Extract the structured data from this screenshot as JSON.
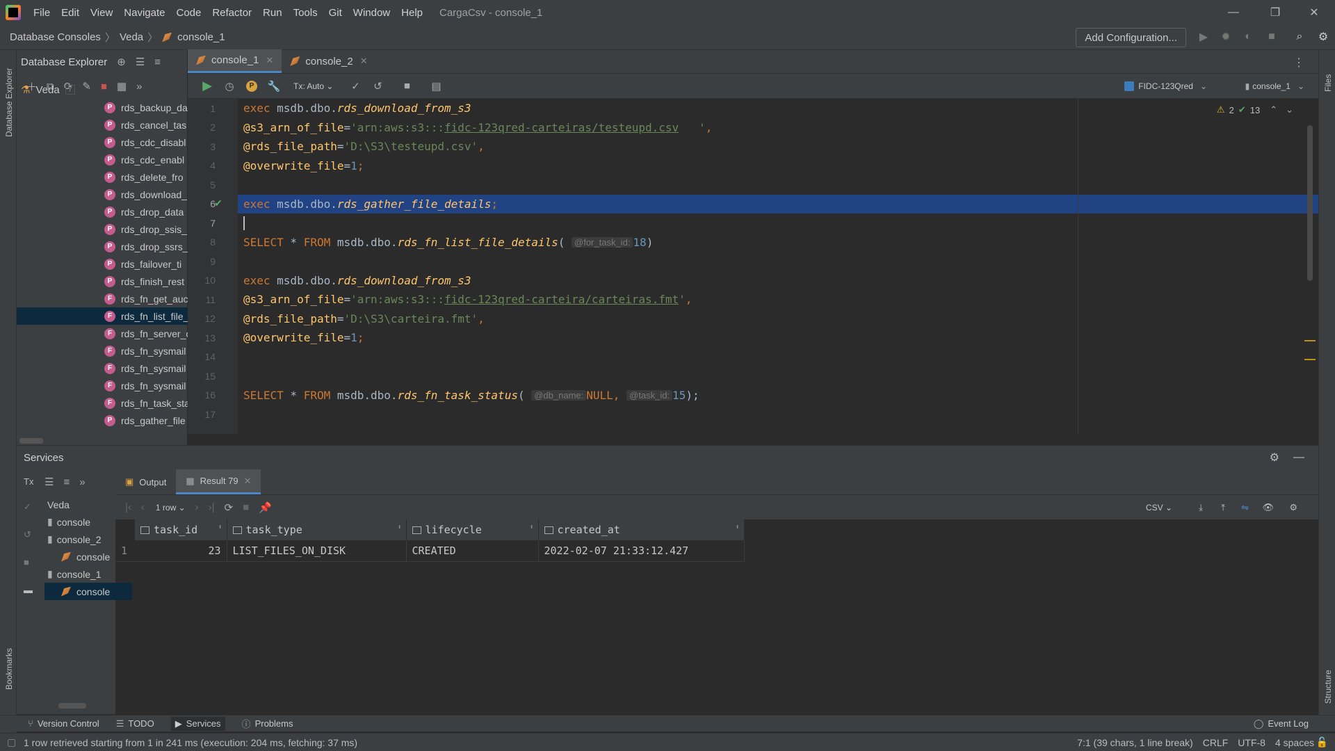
{
  "menu": {
    "items": [
      "File",
      "Edit",
      "View",
      "Navigate",
      "Code",
      "Refactor",
      "Run",
      "Tools",
      "Git",
      "Window",
      "Help"
    ],
    "app_title": "CargaCsv - console_1"
  },
  "breadcrumb": [
    "Database Consoles",
    "Veda",
    "console_1"
  ],
  "nav": {
    "add_config": "Add Configuration..."
  },
  "db_explorer": {
    "title": "Database Explorer",
    "root": "Veda",
    "root_count": "7",
    "items": [
      "rds_backup_da",
      "rds_cancel_tas",
      "rds_cdc_disabl",
      "rds_cdc_enabl",
      "rds_delete_fro",
      "rds_download_",
      "rds_drop_data",
      "rds_drop_ssis_",
      "rds_drop_ssrs_",
      "rds_failover_ti",
      "rds_finish_rest",
      "rds_fn_get_auc",
      "rds_fn_list_file_",
      "rds_fn_server_c",
      "rds_fn_sysmail",
      "rds_fn_sysmail",
      "rds_fn_sysmail",
      "rds_fn_task_sta",
      "rds_gather_file"
    ],
    "selected_index": 12,
    "item_letters": [
      "P",
      "P",
      "P",
      "P",
      "P",
      "P",
      "P",
      "P",
      "P",
      "P",
      "P",
      "F",
      "F",
      "F",
      "F",
      "F",
      "F",
      "F",
      "P"
    ]
  },
  "editor": {
    "tabs": [
      {
        "label": "console_1",
        "active": true
      },
      {
        "label": "console_2",
        "active": false
      }
    ],
    "toolbar": {
      "tx_mode": "Tx: Auto"
    },
    "datasource": "FIDC-123Qred",
    "session": "console_1",
    "inspections": {
      "warnings": "2",
      "ok": "13"
    },
    "line_numbers": [
      "1",
      "2",
      "3",
      "4",
      "5",
      "6",
      "7",
      "8",
      "9",
      "10",
      "11",
      "12",
      "13",
      "14",
      "15",
      "16",
      "17"
    ]
  },
  "code_tokens": {
    "l1_kw": "exec",
    "l1_obj": " msdb.dbo.",
    "l1_fn": "rds_download_from_s3",
    "l2_var": "@s3_arn_of_file",
    "l2_eq": "=",
    "l2_str_a": "'arn:aws:s3:::",
    "l2_str_b": "fidc-123qred-carteiras/testeupd.csv",
    "l2_str_c": "   '",
    "l2_end": ",",
    "l3_var": "@rds_file_path",
    "l3_eq": "=",
    "l3_str": "'D:\\S3\\testeupd.csv'",
    "l3_end": ",",
    "l4_var": "@overwrite_file",
    "l4_eq": "=",
    "l4_num": "1",
    "l4_end": ";",
    "l6_kw": "exec",
    "l6_obj": " msdb.dbo.",
    "l6_fn": "rds_gather_file_details",
    "l6_end": ";",
    "l8_kw1": "SELECT",
    "l8_star": " * ",
    "l8_kw2": "FROM",
    "l8_obj": " msdb.dbo.",
    "l8_fn": "rds_fn_list_file_details",
    "l8_open": "( ",
    "l8_hint": "@for_task_id:",
    "l8_num": "18",
    "l8_close": ")",
    "l10_kw": "exec",
    "l10_obj": " msdb.dbo.",
    "l10_fn": "rds_download_from_s3",
    "l11_var": "@s3_arn_of_file",
    "l11_eq": "=",
    "l11_str_a": "'arn:aws:s3:::",
    "l11_str_b": "fidc-123qred-carteira/carteiras.fmt",
    "l11_str_c": "'",
    "l11_end": ",",
    "l12_var": "@rds_file_path",
    "l12_eq": "=",
    "l12_str": "'D:\\S3\\carteira.fmt'",
    "l12_end": ",",
    "l13_var": "@overwrite_file",
    "l13_eq": "=",
    "l13_num": "1",
    "l13_end": ";",
    "l16_kw1": "SELECT",
    "l16_star": " * ",
    "l16_kw2": "FROM",
    "l16_obj": " msdb.dbo.",
    "l16_fn": "rds_fn_task_status",
    "l16_open": "( ",
    "l16_hint1": "@db_name:",
    "l16_null": "NULL",
    "l16_comma": ", ",
    "l16_hint2": "@task_id:",
    "l16_num": "15",
    "l16_close": ");"
  },
  "services": {
    "title": "Services",
    "tree": [
      "Veda",
      "console",
      "console_2",
      "console",
      "console_1",
      "console"
    ],
    "tabs": [
      {
        "label": "Output"
      },
      {
        "label": "Result 79"
      }
    ],
    "rows_label": "1 row",
    "export_format": "CSV",
    "columns": [
      "task_id",
      "task_type",
      "lifecycle",
      "created_at"
    ],
    "rows": [
      {
        "num": "1",
        "task_id": "23",
        "task_type": "LIST_FILES_ON_DISK",
        "lifecycle": "CREATED",
        "created_at": "2022-02-07 21:33:12.427"
      }
    ]
  },
  "bottom_tools": [
    "Version Control",
    "TODO",
    "Services",
    "Problems"
  ],
  "event_log": "Event Log",
  "left_strip": {
    "db_explorer": "Database Explorer",
    "bookmarks": "Bookmarks"
  },
  "right_strip": {
    "files": "Files",
    "structure": "Structure"
  },
  "status": {
    "message": "1 row retrieved starting from 1 in 241 ms (execution: 204 ms, fetching: 37 ms)",
    "position": "7:1 (39 chars, 1 line break)",
    "line_sep": "CRLF",
    "encoding": "UTF-8",
    "indent": "4 spaces"
  }
}
